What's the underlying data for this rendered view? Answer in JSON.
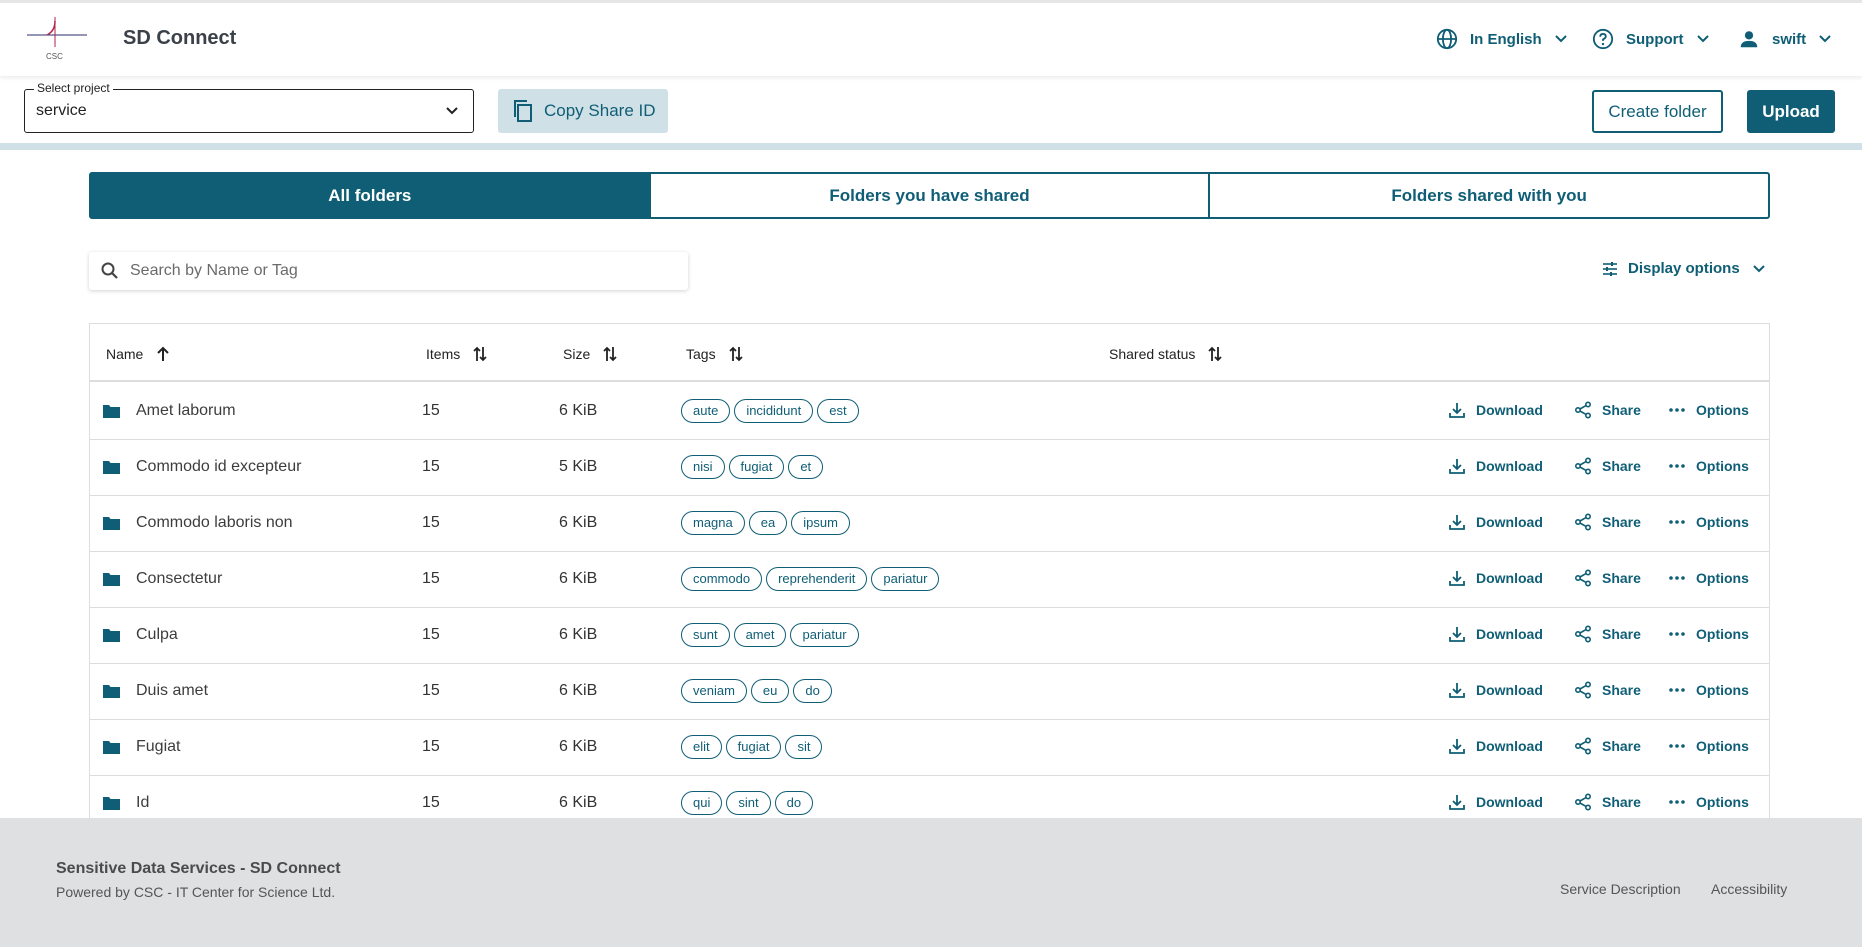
{
  "header": {
    "logo_text": "CSC",
    "app_title": "SD Connect",
    "language": "In English",
    "support": "Support",
    "user": "swift"
  },
  "projectbar": {
    "select_label": "Select project",
    "select_value": "service",
    "copy_share_id": "Copy Share ID",
    "create_folder": "Create folder",
    "upload": "Upload"
  },
  "tabs": [
    "All folders",
    "Folders you have shared",
    "Folders shared with you"
  ],
  "search": {
    "placeholder": "Search by Name or Tag"
  },
  "display_options": "Display options",
  "table": {
    "columns": {
      "name": "Name",
      "items": "Items",
      "size": "Size",
      "tags": "Tags",
      "shared_status": "Shared status"
    },
    "actions": {
      "download": "Download",
      "share": "Share",
      "options": "Options"
    },
    "rows": [
      {
        "name": "Amet laborum",
        "items": "15",
        "size": "6 KiB",
        "tags": [
          "aute",
          "incididunt",
          "est"
        ]
      },
      {
        "name": "Commodo id excepteur",
        "items": "15",
        "size": "5 KiB",
        "tags": [
          "nisi",
          "fugiat",
          "et"
        ]
      },
      {
        "name": "Commodo laboris non",
        "items": "15",
        "size": "6 KiB",
        "tags": [
          "magna",
          "ea",
          "ipsum"
        ]
      },
      {
        "name": "Consectetur",
        "items": "15",
        "size": "6 KiB",
        "tags": [
          "commodo",
          "reprehenderit",
          "pariatur"
        ]
      },
      {
        "name": "Culpa",
        "items": "15",
        "size": "6 KiB",
        "tags": [
          "sunt",
          "amet",
          "pariatur"
        ]
      },
      {
        "name": "Duis amet",
        "items": "15",
        "size": "6 KiB",
        "tags": [
          "veniam",
          "eu",
          "do"
        ]
      },
      {
        "name": "Fugiat",
        "items": "15",
        "size": "6 KiB",
        "tags": [
          "elit",
          "fugiat",
          "sit"
        ]
      },
      {
        "name": "Id",
        "items": "15",
        "size": "6 KiB",
        "tags": [
          "qui",
          "sint",
          "do"
        ]
      }
    ]
  },
  "footer": {
    "title": "Sensitive Data Services - SD Connect",
    "subtitle": "Powered by CSC - IT Center for Science Ltd.",
    "links": [
      "Service Description",
      "Accessibility"
    ]
  },
  "colors": {
    "accent": "#0f5e76",
    "accent_light": "#cfe1e7",
    "footer_bg": "#dfe0e2"
  }
}
